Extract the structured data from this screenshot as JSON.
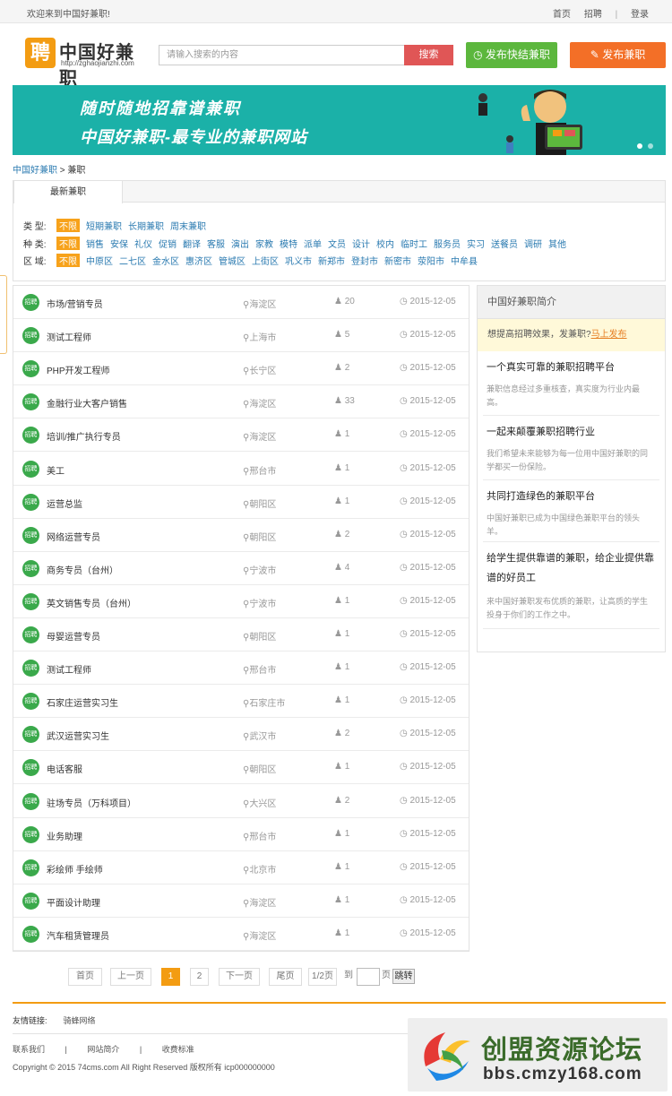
{
  "topbar": {
    "welcome": "欢迎来到中国好兼职!",
    "nav": [
      "首页",
      "招聘",
      "登录"
    ],
    "sep": "|"
  },
  "header": {
    "logo_mark": "聘",
    "logo_name": "中国好兼职",
    "logo_url": "http://zghaojianzhi.com",
    "search_placeholder": "请输入搜索的内容",
    "search_label": "搜索",
    "quick_post_label": "发布快结兼职",
    "post_label": "发布兼职"
  },
  "banner": {
    "line1": "随时随地招靠谱兼职",
    "line2": "中国好兼职-最专业的兼职网站"
  },
  "breadcrumb": {
    "home": "中国好兼职",
    "sep": ">",
    "current": "兼职"
  },
  "tab": "最新兼职",
  "filters": [
    {
      "label": "类  型:",
      "tags": [
        "不限",
        "短期兼职",
        "长期兼职",
        "周末兼职"
      ]
    },
    {
      "label": "种  类:",
      "tags": [
        "不限",
        "销售",
        "安保",
        "礼仪",
        "促销",
        "翻译",
        "客服",
        "演出",
        "家教",
        "模特",
        "派单",
        "文员",
        "设计",
        "校内",
        "临时工",
        "服务员",
        "实习",
        "送餐员",
        "调研",
        "其他"
      ]
    },
    {
      "label": "区  域:",
      "tags": [
        "不限",
        "中原区",
        "二七区",
        "金水区",
        "惠济区",
        "管城区",
        "上街区",
        "巩义市",
        "新郑市",
        "登封市",
        "新密市",
        "荥阳市",
        "中牟县"
      ]
    }
  ],
  "jobs": [
    {
      "badge": "招聘",
      "title": "市场/营销专员",
      "loc": "海淀区",
      "count": "20",
      "date": "2015-12-05"
    },
    {
      "badge": "招聘",
      "title": "测试工程师",
      "loc": "上海市",
      "count": "5",
      "date": "2015-12-05"
    },
    {
      "badge": "招聘",
      "title": "PHP开发工程师",
      "loc": "长宁区",
      "count": "2",
      "date": "2015-12-05"
    },
    {
      "badge": "招聘",
      "title": "金融行业大客户销售",
      "loc": "海淀区",
      "count": "33",
      "date": "2015-12-05"
    },
    {
      "badge": "招聘",
      "title": "培训/推广执行专员",
      "loc": "海淀区",
      "count": "1",
      "date": "2015-12-05"
    },
    {
      "badge": "招聘",
      "title": "美工",
      "loc": "邢台市",
      "count": "1",
      "date": "2015-12-05"
    },
    {
      "badge": "招聘",
      "title": "运营总监",
      "loc": "朝阳区",
      "count": "1",
      "date": "2015-12-05"
    },
    {
      "badge": "招聘",
      "title": "网络运营专员",
      "loc": "朝阳区",
      "count": "2",
      "date": "2015-12-05"
    },
    {
      "badge": "招聘",
      "title": "商务专员（台州）",
      "loc": "宁波市",
      "count": "4",
      "date": "2015-12-05"
    },
    {
      "badge": "招聘",
      "title": "英文销售专员（台州）",
      "loc": "宁波市",
      "count": "1",
      "date": "2015-12-05"
    },
    {
      "badge": "招聘",
      "title": "母婴运营专员",
      "loc": "朝阳区",
      "count": "1",
      "date": "2015-12-05"
    },
    {
      "badge": "招聘",
      "title": "测试工程师",
      "loc": "邢台市",
      "count": "1",
      "date": "2015-12-05"
    },
    {
      "badge": "招聘",
      "title": "石家庄运营实习生",
      "loc": "石家庄市",
      "count": "1",
      "date": "2015-12-05"
    },
    {
      "badge": "招聘",
      "title": "武汉运营实习生",
      "loc": "武汉市",
      "count": "2",
      "date": "2015-12-05"
    },
    {
      "badge": "招聘",
      "title": "电话客服",
      "loc": "朝阳区",
      "count": "1",
      "date": "2015-12-05"
    },
    {
      "badge": "招聘",
      "title": "驻场专员（万科项目）",
      "loc": "大兴区",
      "count": "2",
      "date": "2015-12-05"
    },
    {
      "badge": "招聘",
      "title": "业务助理",
      "loc": "邢台市",
      "count": "1",
      "date": "2015-12-05"
    },
    {
      "badge": "招聘",
      "title": "彩绘师 手绘师",
      "loc": "北京市",
      "count": "1",
      "date": "2015-12-05"
    },
    {
      "badge": "招聘",
      "title": "平面设计助理",
      "loc": "海淀区",
      "count": "1",
      "date": "2015-12-05"
    },
    {
      "badge": "招聘",
      "title": "汽车租赁管理员",
      "loc": "海淀区",
      "count": "1",
      "date": "2015-12-05"
    }
  ],
  "side": {
    "head": "中国好兼职简介",
    "promo_text": "想提高招聘效果，发兼职?",
    "promo_link": "马上发布",
    "items": [
      {
        "title": "一个真实可靠的兼职招聘平台",
        "desc": "兼职信息经过多重核查，真实度为行业内最高。"
      },
      {
        "title": "一起来颠覆兼职招聘行业",
        "desc": "我们希望未来能够为每一位用中国好兼职的同学都买一份保险。"
      },
      {
        "title": "共同打造绿色的兼职平台",
        "desc": "中国好兼职已成为中国绿色兼职平台的领头羊。"
      },
      {
        "title": "给学生提供靠谱的兼职，给企业提供靠谱的好员工",
        "desc": "来中国好兼职发布优质的兼职，让高质的学生投身于你们的工作之中。"
      }
    ]
  },
  "pager": {
    "first": "首页",
    "prev": "上一页",
    "p1": "1",
    "p2": "2",
    "next": "下一页",
    "last": "尾页",
    "info": "1/2页",
    "to": "到",
    "page": "页",
    "go": "跳转"
  },
  "footer": {
    "friend_label": "友情链接:",
    "friend_link": "骑蜂网络",
    "links": [
      "联系我们",
      "|",
      "网站简介",
      "|",
      "收费标准"
    ],
    "copyright": "Copyright © 2015 74cms.com All Right Reserved 版权所有 icp000000000"
  },
  "watermark": {
    "big": "创盟资源论坛",
    "small": "bbs.cmzy168.com"
  }
}
